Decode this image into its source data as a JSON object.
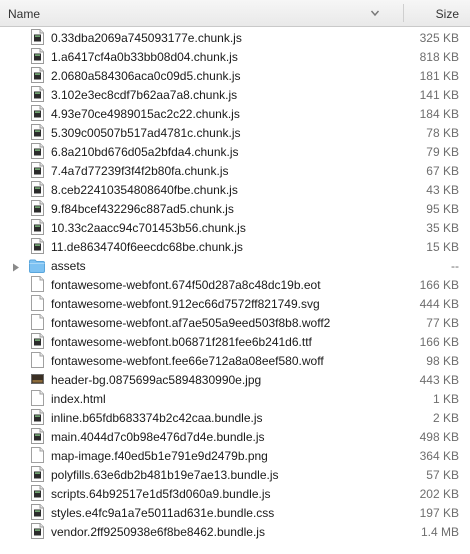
{
  "header": {
    "name_label": "Name",
    "size_label": "Size"
  },
  "files": [
    {
      "name": "0.33dba2069a745093177e.chunk.js",
      "size": "325 KB",
      "icon": "exec"
    },
    {
      "name": "1.a6417cf4a0b33bb08d04.chunk.js",
      "size": "818 KB",
      "icon": "exec"
    },
    {
      "name": "2.0680a584306aca0c09d5.chunk.js",
      "size": "181 KB",
      "icon": "exec"
    },
    {
      "name": "3.102e3ec8cdf7b62aa7a8.chunk.js",
      "size": "141 KB",
      "icon": "exec"
    },
    {
      "name": "4.93e70ce4989015ac2c22.chunk.js",
      "size": "184 KB",
      "icon": "exec"
    },
    {
      "name": "5.309c00507b517ad4781c.chunk.js",
      "size": "78 KB",
      "icon": "exec"
    },
    {
      "name": "6.8a210bd676d05a2bfda4.chunk.js",
      "size": "79 KB",
      "icon": "exec"
    },
    {
      "name": "7.4a7d77239f3f4f2b80fa.chunk.js",
      "size": "67 KB",
      "icon": "exec"
    },
    {
      "name": "8.ceb22410354808640fbe.chunk.js",
      "size": "43 KB",
      "icon": "exec"
    },
    {
      "name": "9.f84bcef432296c887ad5.chunk.js",
      "size": "95 KB",
      "icon": "exec"
    },
    {
      "name": "10.33c2aacc94c701453b56.chunk.js",
      "size": "35 KB",
      "icon": "exec"
    },
    {
      "name": "11.de8634740f6eecdc68be.chunk.js",
      "size": "15 KB",
      "icon": "exec"
    },
    {
      "name": "assets",
      "size": "--",
      "icon": "folder"
    },
    {
      "name": "fontawesome-webfont.674f50d287a8c48dc19b.eot",
      "size": "166 KB",
      "icon": "doc"
    },
    {
      "name": "fontawesome-webfont.912ec66d7572ff821749.svg",
      "size": "444 KB",
      "icon": "doc"
    },
    {
      "name": "fontawesome-webfont.af7ae505a9eed503f8b8.woff2",
      "size": "77 KB",
      "icon": "doc"
    },
    {
      "name": "fontawesome-webfont.b06871f281fee6b241d6.ttf",
      "size": "166 KB",
      "icon": "exec"
    },
    {
      "name": "fontawesome-webfont.fee66e712a8a08eef580.woff",
      "size": "98 KB",
      "icon": "doc"
    },
    {
      "name": "header-bg.0875699ac5894830990e.jpg",
      "size": "443 KB",
      "icon": "image"
    },
    {
      "name": "index.html",
      "size": "1 KB",
      "icon": "doc"
    },
    {
      "name": "inline.b65fdb683374b2c42caa.bundle.js",
      "size": "2 KB",
      "icon": "exec"
    },
    {
      "name": "main.4044d7c0b98e476d7d4e.bundle.js",
      "size": "498 KB",
      "icon": "exec"
    },
    {
      "name": "map-image.f40ed5b1e791e9d2479b.png",
      "size": "364 KB",
      "icon": "doc"
    },
    {
      "name": "polyfills.63e6db2b481b19e7ae13.bundle.js",
      "size": "57 KB",
      "icon": "exec"
    },
    {
      "name": "scripts.64b92517e1d5f3d060a9.bundle.js",
      "size": "202 KB",
      "icon": "exec"
    },
    {
      "name": "styles.e4fc9a1a7e5011ad631e.bundle.css",
      "size": "197 KB",
      "icon": "exec"
    },
    {
      "name": "vendor.2ff9250938e6f8be8462.bundle.js",
      "size": "1.4 MB",
      "icon": "exec"
    }
  ]
}
